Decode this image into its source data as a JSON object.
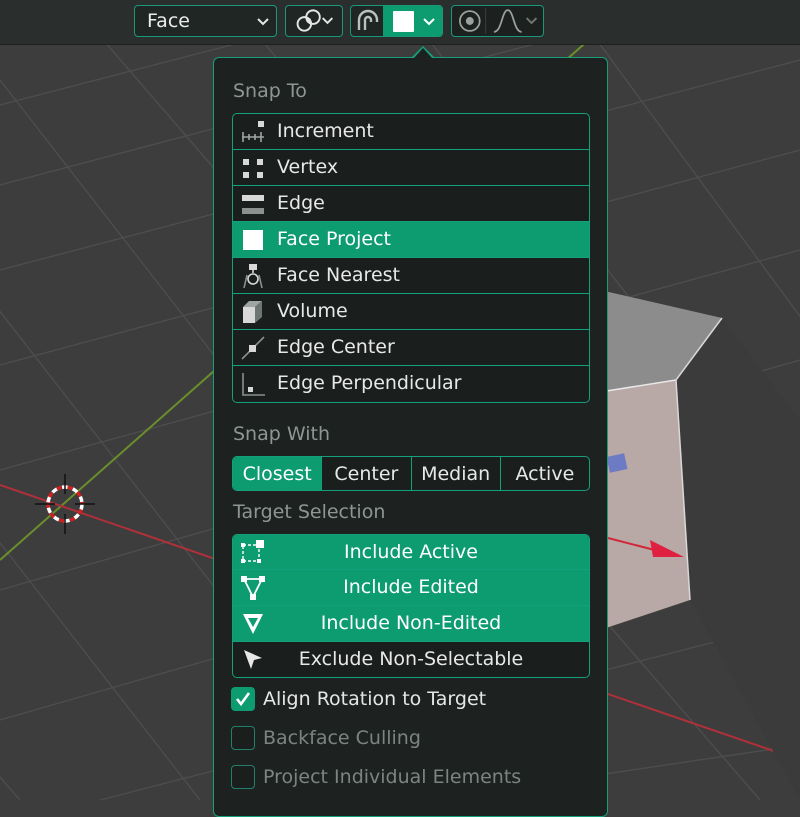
{
  "header": {
    "snap_target_value": "Face",
    "snap_target_options_icon": "chevron-down-icon",
    "snap_element_icon": "square-icon",
    "proportional_icon": "falloff-curve-icon"
  },
  "snap_to": {
    "heading": "Snap To",
    "items": [
      {
        "label": "Increment",
        "icon": "increment-icon",
        "selected": false
      },
      {
        "label": "Vertex",
        "icon": "vertex-icon",
        "selected": false
      },
      {
        "label": "Edge",
        "icon": "edge-icon",
        "selected": false
      },
      {
        "label": "Face Project",
        "icon": "face-project-icon",
        "selected": true
      },
      {
        "label": "Face Nearest",
        "icon": "face-nearest-icon",
        "selected": false
      },
      {
        "label": "Volume",
        "icon": "volume-icon",
        "selected": false
      },
      {
        "label": "Edge Center",
        "icon": "edge-center-icon",
        "selected": false
      },
      {
        "label": "Edge Perpendicular",
        "icon": "edge-perpendicular-icon",
        "selected": false
      }
    ]
  },
  "snap_with": {
    "heading": "Snap With",
    "options": [
      "Closest",
      "Center",
      "Median",
      "Active"
    ],
    "selected": "Closest"
  },
  "target_selection": {
    "heading": "Target Selection",
    "items": [
      {
        "label": "Include Active",
        "icon": "include-active-icon",
        "selected": true
      },
      {
        "label": "Include Edited",
        "icon": "include-edited-icon",
        "selected": true
      },
      {
        "label": "Include Non-Edited",
        "icon": "include-non-edited-icon",
        "selected": true
      },
      {
        "label": "Exclude Non-Selectable",
        "icon": "cursor-arrow-icon",
        "selected": false
      }
    ]
  },
  "options": [
    {
      "label": "Align Rotation to Target",
      "checked": true
    },
    {
      "label": "Backface Culling",
      "checked": false
    },
    {
      "label": "Project Individual Elements",
      "checked": false
    }
  ],
  "colors": {
    "accent": "#0d9b70",
    "border": "#14a07a",
    "panel_bg": "#1d2220",
    "viewport_bg": "#3d3d3d",
    "x_axis": "#c0303a",
    "y_axis": "#6a8f2a"
  }
}
